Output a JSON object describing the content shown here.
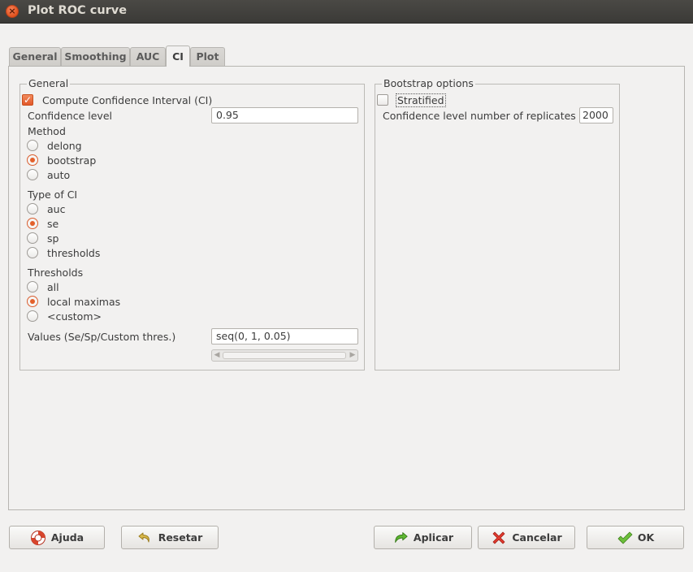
{
  "window": {
    "title": "Plot ROC curve"
  },
  "tabs": [
    {
      "label": "General"
    },
    {
      "label": "Smoothing"
    },
    {
      "label": "AUC"
    },
    {
      "label": "CI"
    },
    {
      "label": "Plot"
    }
  ],
  "general": {
    "frame_label": "General",
    "compute_ci": {
      "label": "Compute Confidence Interval (CI)",
      "checked": true
    },
    "confidence_level": {
      "label": "Confidence level",
      "value": "0.95"
    },
    "method": {
      "label": "Method",
      "options": [
        "delong",
        "bootstrap",
        "auto"
      ],
      "selected": "bootstrap"
    },
    "type_of_ci": {
      "label": "Type of CI",
      "options": [
        "auc",
        "se",
        "sp",
        "thresholds"
      ],
      "selected": "se"
    },
    "thresholds": {
      "label": "Thresholds",
      "options": [
        "all",
        "local maximas",
        "<custom>"
      ],
      "selected": "local maximas"
    },
    "values": {
      "label": "Values (Se/Sp/Custom thres.)",
      "value": "seq(0, 1, 0.05)"
    }
  },
  "bootstrap": {
    "frame_label": "Bootstrap options",
    "stratified": {
      "label": "Stratified",
      "checked": false
    },
    "replicates": {
      "label": "Confidence level number of replicates",
      "value": "2000"
    }
  },
  "buttons": {
    "help": "Ajuda",
    "reset": "Resetar",
    "apply": "Aplicar",
    "cancel": "Cancelar",
    "ok": "OK"
  },
  "colors": {
    "accent": "#e3602b",
    "titlebar": "#3b3a37",
    "background": "#f2f1f0"
  }
}
